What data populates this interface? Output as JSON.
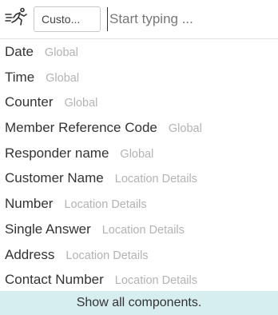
{
  "toolbar": {
    "runner_icon": "runner-icon",
    "type_select_value": "Custo...",
    "search_placeholder": "Start typing ..."
  },
  "components": [
    {
      "name": "Date",
      "scope": "Global"
    },
    {
      "name": "Time",
      "scope": "Global"
    },
    {
      "name": "Counter",
      "scope": "Global"
    },
    {
      "name": "Member Reference Code",
      "scope": "Global"
    },
    {
      "name": "Responder name",
      "scope": "Global"
    },
    {
      "name": "Customer Name",
      "scope": "Location Details"
    },
    {
      "name": "Number",
      "scope": "Location Details"
    },
    {
      "name": "Single Answer",
      "scope": "Location Details"
    },
    {
      "name": "Address",
      "scope": "Location Details"
    },
    {
      "name": "Contact Number",
      "scope": "Location Details"
    }
  ],
  "footer": {
    "show_all_label": "Show all components."
  },
  "colors": {
    "footer_bg": "#d6eef0",
    "scope_text": "#b3b3b3",
    "primary_text": "#333333"
  }
}
